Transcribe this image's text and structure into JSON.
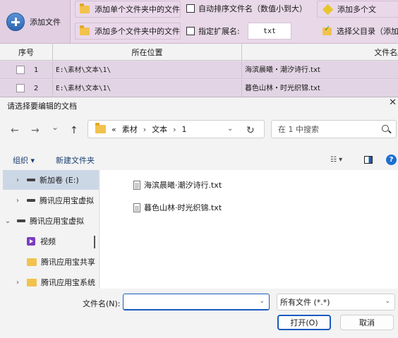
{
  "app": {
    "toolbar": {
      "add_file": "添加文件",
      "add_single_folder": "添加单个文件夹中的文件",
      "add_multi_folder": "添加多个文件夹中的文件",
      "auto_sort": "自动排序文件名（数值小到大）",
      "specify_ext": "指定扩展名:",
      "ext_value": "txt",
      "add_multi_right": "添加多个文",
      "select_parent": "选择父目录（添加"
    },
    "grid": {
      "headers": [
        "序号",
        "所在位置",
        "文件名/"
      ],
      "rows": [
        {
          "num": "1",
          "path": "E:\\素材\\文本\\1\\",
          "name": "海滨晨曦・潮汐诗行.txt"
        },
        {
          "num": "2",
          "path": "E:\\素材\\文本\\1\\",
          "name": "暮色山林・时光织锦.txt"
        }
      ]
    }
  },
  "dialog": {
    "title": "请选择要编辑的文档",
    "close": "✕",
    "nav": {
      "back": "←",
      "forward": "→",
      "dropdown": "⌄",
      "up": "↑",
      "refresh": "↻"
    },
    "address": {
      "chevrons": "«",
      "segments": [
        "素材",
        "文本",
        "1"
      ],
      "sep": "›",
      "dropdown": "⌄"
    },
    "search_placeholder": "在 1 中搜索",
    "commands": {
      "organize": "组织 ▾",
      "new_folder": "新建文件夹",
      "view": "☷ ▾",
      "help": "?"
    },
    "nav_pane": [
      {
        "label": "新加卷 (E:)",
        "chev": "›",
        "icon": "drive",
        "selected": true
      },
      {
        "label": "腾讯应用宝虚拟",
        "chev": "›",
        "icon": "drive",
        "selected": false
      },
      {
        "label": "腾讯应用宝虚拟",
        "chev": "⌄",
        "icon": "drive",
        "selected": false
      },
      {
        "label": "视频",
        "chev": "",
        "icon": "video",
        "selected": false
      },
      {
        "label": "腾讯应用宝共享",
        "chev": "",
        "icon": "folder",
        "selected": false
      },
      {
        "label": "腾讯应用宝系统",
        "chev": "›",
        "icon": "folder",
        "selected": false
      }
    ],
    "files": [
      "海滨晨曦·潮汐诗行.txt",
      "暮色山林·时光织锦.txt"
    ],
    "filename_label": "文件名(N):",
    "filename_value": "",
    "filetype": "所有文件 (*.*)",
    "open_button": "打开(O)",
    "cancel_button": "取消"
  }
}
